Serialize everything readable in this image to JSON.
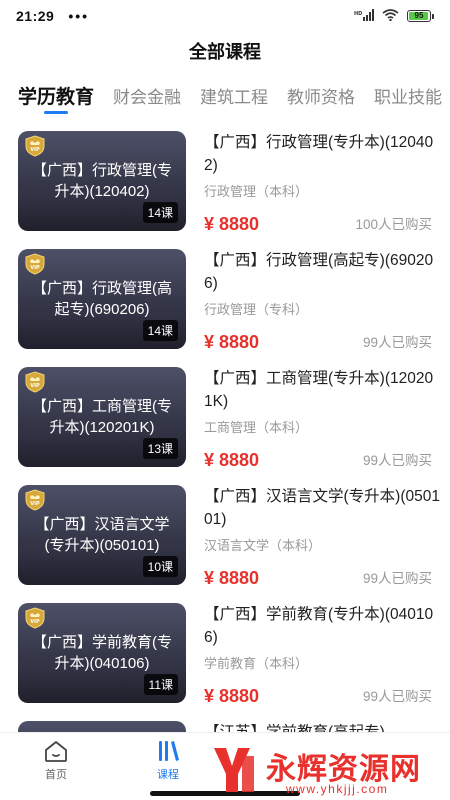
{
  "status_bar": {
    "time": "21:29",
    "dots": "•••",
    "battery": "95"
  },
  "page": {
    "title": "全部课程"
  },
  "tabs": [
    {
      "label": "学历教育",
      "active": true
    },
    {
      "label": "财会金融",
      "active": false
    },
    {
      "label": "建筑工程",
      "active": false
    },
    {
      "label": "教师资格",
      "active": false
    },
    {
      "label": "职业技能",
      "active": false
    }
  ],
  "courses": [
    {
      "thumb_title": "【广西】行政管理(专升本)(120402)",
      "lesson_count": "14课",
      "title": "【广西】行政管理(专升本)(120402)",
      "level": "行政管理（本科）",
      "price": "¥ 8880",
      "buyers": "100人已购买"
    },
    {
      "thumb_title": "【广西】行政管理(高起专)(690206)",
      "lesson_count": "14课",
      "title": "【广西】行政管理(高起专)(690206)",
      "level": "行政管理（专科）",
      "price": "¥ 8880",
      "buyers": "99人已购买"
    },
    {
      "thumb_title": "【广西】工商管理(专升本)(120201K)",
      "lesson_count": "13课",
      "title": "【广西】工商管理(专升本)(120201K)",
      "level": "工商管理（本科）",
      "price": "¥ 8880",
      "buyers": "99人已购买"
    },
    {
      "thumb_title": "【广西】汉语言文学(专升本)(050101)",
      "lesson_count": "10课",
      "title": "【广西】汉语言文学(专升本)(050101)",
      "level": "汉语言文学（本科）",
      "price": "¥ 8880",
      "buyers": "99人已购买"
    },
    {
      "thumb_title": "【广西】学前教育(专升本)(040106)",
      "lesson_count": "11课",
      "title": "【广西】学前教育(专升本)(040106)",
      "level": "学前教育（本科）",
      "price": "¥ 8880",
      "buyers": "99人已购买"
    },
    {
      "thumb_title": "",
      "lesson_count": "",
      "title": "【江苏】学前教育(高起专)",
      "level": "",
      "price": "",
      "buyers": ""
    }
  ],
  "bottom_nav": {
    "home_label": "首页",
    "course_label": "课程",
    "accent_color": "#1e7cf0"
  },
  "watermark": {
    "text": "永辉资源网",
    "url": "www.yhkjjj.com"
  },
  "colors": {
    "price": "#e8302c",
    "tab_indicator": "#1e7cf0",
    "battery": "#5ac84b"
  }
}
